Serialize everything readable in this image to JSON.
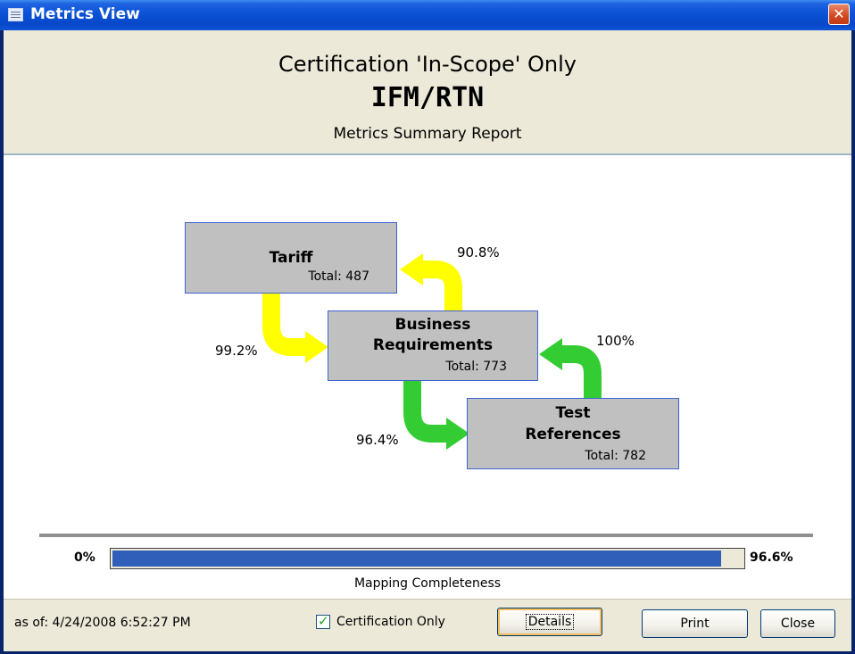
{
  "window": {
    "title": "Metrics View",
    "close_glyph": "✕"
  },
  "header": {
    "line1": "Certification 'In-Scope' Only",
    "line2": "IFM/RTN",
    "line3": "Metrics Summary Report"
  },
  "diagram": {
    "boxes": [
      {
        "name": "Tariff",
        "total": "Total: 487"
      },
      {
        "name_line1": "Business",
        "name_line2": "Requirements",
        "total": "Total: 773"
      },
      {
        "name_line1": "Test",
        "name_line2": "References",
        "total": "Total: 782"
      }
    ],
    "arrows": [
      {
        "label": "90.8%",
        "color": "#ffff00"
      },
      {
        "label": "99.2%",
        "color": "#ffff00"
      },
      {
        "label": "100%",
        "color": "#33cc33"
      },
      {
        "label": "96.4%",
        "color": "#33cc33"
      }
    ]
  },
  "progress": {
    "start_label": "0%",
    "end_label": "96.6%",
    "value_fraction": 0.966,
    "caption": "Mapping Completeness",
    "fill_color": "#2f5fb8"
  },
  "footer": {
    "as_of": "as of:  4/24/2008 6:52:27 PM",
    "checkbox_label": "Certification Only",
    "checkbox_checked": true,
    "details_label": "Details",
    "print_label": "Print",
    "close_label": "Close"
  }
}
